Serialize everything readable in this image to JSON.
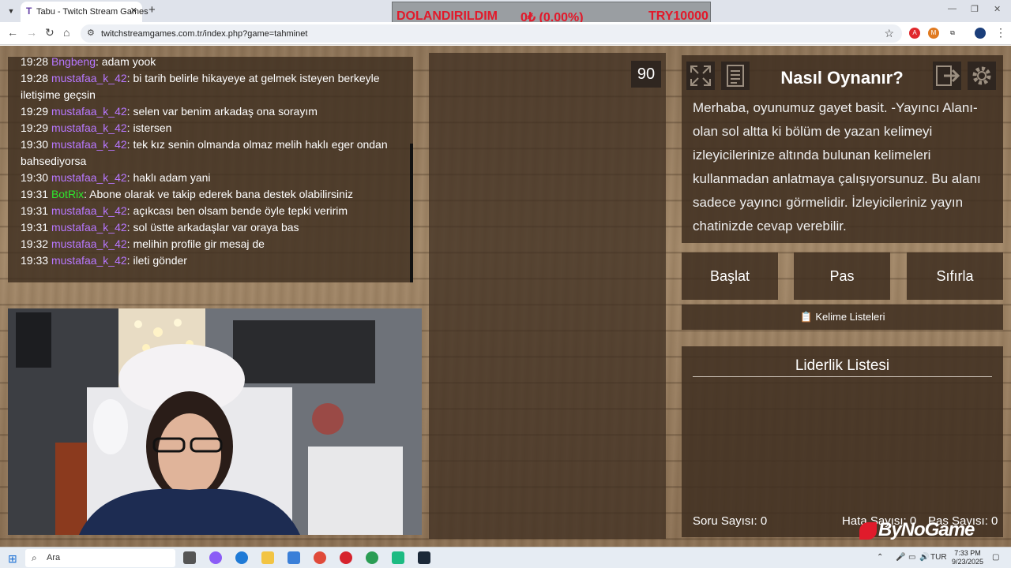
{
  "browser": {
    "tab_title": "Tabu - Twitch Stream Games",
    "url": "twitchstreamgames.com.tr/index.php?game=tahminet"
  },
  "overlay": {
    "label": "DOLANDIRILDIM",
    "amount": "0₺ (0.00%)",
    "target": "TRY10000"
  },
  "chat": {
    "messages": [
      {
        "time": "19:28",
        "user": "Bngbeng",
        "text": ": adam yook",
        "color": "purple"
      },
      {
        "time": "19:28",
        "user": "mustafaa_k_42",
        "text": ": bi tarih belirle hikayeye at gelmek isteyen berkeyle iletişime geçsin",
        "color": "purple"
      },
      {
        "time": "19:29",
        "user": "mustafaa_k_42",
        "text": ": selen var benim arkadaş ona sorayım",
        "color": "purple"
      },
      {
        "time": "19:29",
        "user": "mustafaa_k_42",
        "text": ": istersen",
        "color": "purple"
      },
      {
        "time": "19:30",
        "user": "mustafaa_k_42",
        "text": ": tek kız senin olmanda olmaz melih haklı eger ondan bahsediyorsa",
        "color": "purple"
      },
      {
        "time": "19:30",
        "user": "mustafaa_k_42",
        "text": ": haklı adam yani",
        "color": "purple"
      },
      {
        "time": "19:31",
        "user": "BotRix",
        "text": ": Abone olarak ve takip ederek bana destek olabilirsiniz",
        "color": "green"
      },
      {
        "time": "19:31",
        "user": "mustafaa_k_42",
        "text": ": açıkcası ben olsam bende öyle tepki veririm",
        "color": "purple"
      },
      {
        "time": "19:31",
        "user": "mustafaa_k_42",
        "text": ": sol üstte arkadaşlar var oraya bas",
        "color": "purple"
      },
      {
        "time": "19:32",
        "user": "mustafaa_k_42",
        "text": ": melihin profile gir mesaj de",
        "color": "purple"
      },
      {
        "time": "19:33",
        "user": "mustafaa_k_42",
        "text": ": ileti gönder",
        "color": "purple"
      }
    ]
  },
  "game": {
    "timer": "90",
    "info_title": "Nasıl Oynanır?",
    "info_text": "Merhaba, oyunumuz gayet basit. -Yayıncı Alanı- olan sol altta ki bölüm de yazan kelimeyi izleyicilerinize altında bulunan kelimeleri kullanmadan anlatmaya çalışıyorsunuz. Bu alanı sadece yayıncı görmelidir. İzleyicileriniz yayın chatinizde cevap verebilir.",
    "buttons": {
      "start": "Başlat",
      "pass": "Pas",
      "reset": "Sıfırla"
    },
    "word_lists": "📋 Kelime Listeleri",
    "leaderboard_title": "Liderlik Listesi",
    "stats": {
      "questions": "Soru Sayısı: 0",
      "errors": "Hata Sayısı: 0",
      "passes": "Pas Sayısı: 0"
    },
    "watermark": "ByNoGame"
  },
  "taskbar": {
    "search_placeholder": "Ara",
    "language": "TUR",
    "time": "7:33 PM",
    "date": "9/23/2025"
  }
}
